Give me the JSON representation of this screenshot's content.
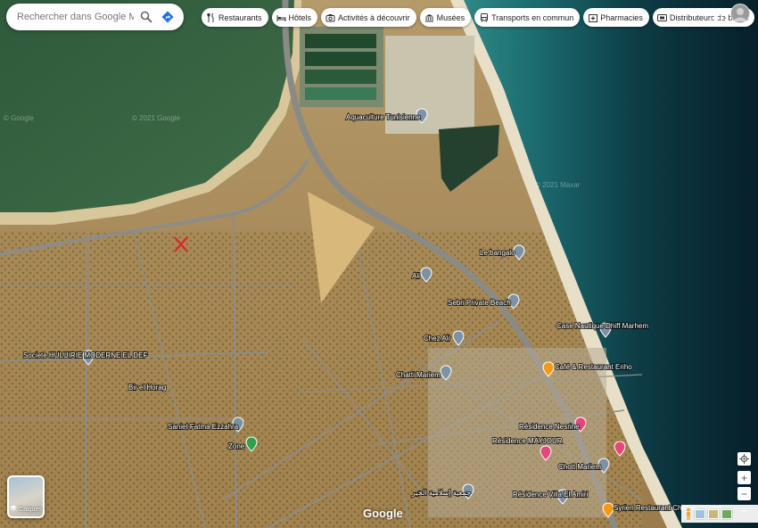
{
  "search": {
    "placeholder": "Rechercher dans Google Maps"
  },
  "chips": [
    {
      "label": "Restaurants",
      "icon": "fork-knife-icon"
    },
    {
      "label": "Hôtels",
      "icon": "bed-icon"
    },
    {
      "label": "Activités à découvrir",
      "icon": "camera-icon"
    },
    {
      "label": "Musées",
      "icon": "museum-icon"
    },
    {
      "label": "Transports en commun",
      "icon": "bus-icon"
    },
    {
      "label": "Pharmacies",
      "icon": "pharmacy-icon"
    },
    {
      "label": "Distributeurs de billets",
      "icon": "atm-icon"
    }
  ],
  "places": [
    {
      "name": "Aquaculture Tunisienne",
      "pin": "grey"
    },
    {
      "name": "Le bangalo",
      "pin": "grey"
    },
    {
      "name": "Ali",
      "pin": "grey"
    },
    {
      "name": "Sebri Private Beach",
      "pin": "grey"
    },
    {
      "name": "Case Nautique Dhiff Marhem",
      "pin": "grey"
    },
    {
      "name": "Chez Ali",
      "pin": "grey"
    },
    {
      "name": "Societe HULUIRIE MODERNE EL DEF",
      "pin": "grey"
    },
    {
      "name": "Chatti Mariem",
      "pin": "grey"
    },
    {
      "name": "Café & Restaurant Eriho",
      "pin": "orange"
    },
    {
      "name": "Bir el Horag",
      "pin": "none"
    },
    {
      "name": "Saniet Fatma Ezzahra",
      "pin": "grey"
    },
    {
      "name": "Zone",
      "pin": "green"
    },
    {
      "name": "Résidence Nesrine",
      "pin": "pink"
    },
    {
      "name": "Résidence MAYJOUR",
      "pin": "pink"
    },
    {
      "name": "Chott Mariem",
      "pin": "grey"
    },
    {
      "name": "Résidence Villa El Amiri",
      "pin": "grey"
    },
    {
      "name": "جمعية إسلامية الخير",
      "pin": "grey"
    },
    {
      "name": "Syrien Restaurant Chateau Galeb",
      "pin": "orange"
    }
  ],
  "credits": [
    "© Google",
    "© 2021 Google",
    "© 2021 Maxar"
  ],
  "layers_label": "Calques",
  "logo": "Google",
  "controls": {
    "zoom_in": "+",
    "zoom_out": "−",
    "expand": "⌃"
  },
  "colors": {
    "pin_grey": "#7d93a5",
    "pin_orange": "#f39c12",
    "pin_pink": "#e8457a",
    "pin_green": "#2ba24c",
    "search_blue": "#1a73e8"
  }
}
